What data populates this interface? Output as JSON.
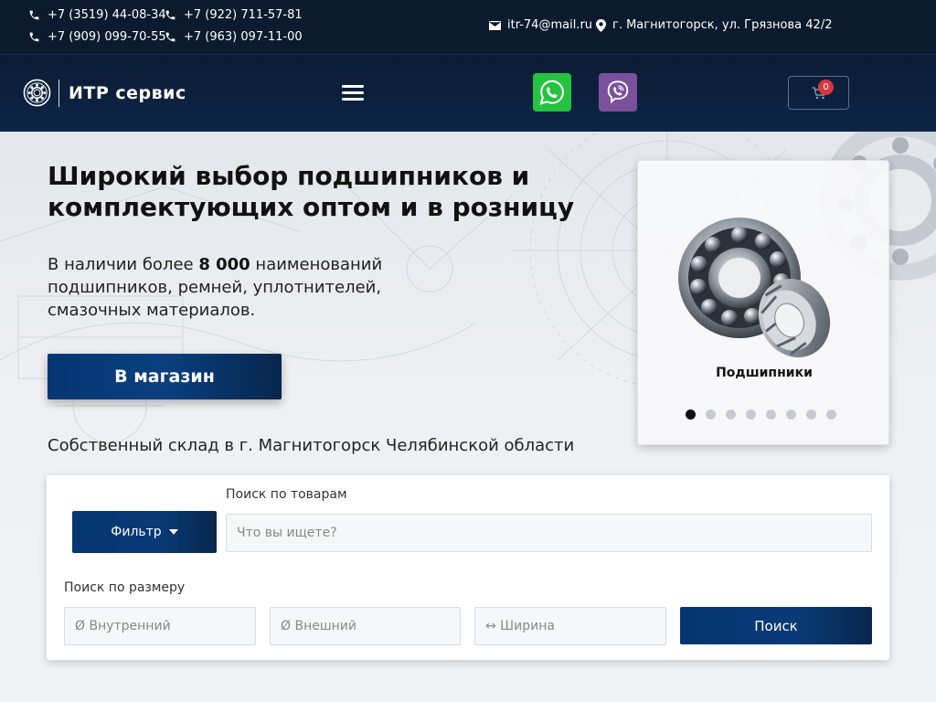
{
  "topbar": {
    "phones": [
      "+7 (3519) 44-08-34",
      "+7 (922) 711-57-81",
      "+7 (909) 099-70-55",
      "+7 (963) 097-11-00"
    ],
    "email": "itr-74@mail.ru",
    "address": "г. Магнитогорск, ул. Грязнова 42/2",
    "icons": {
      "phone": "phone-icon",
      "email": "envelope-icon",
      "address": "map-pin-icon"
    }
  },
  "header": {
    "logo_text": "ИТР сервис",
    "cart_count": "0",
    "whatsapp_color": "#25c23f",
    "viber_color": "#7b519d",
    "icons": [
      "bearing-logo-icon",
      "menu-icon",
      "whatsapp-icon",
      "viber-icon",
      "cart-icon"
    ]
  },
  "hero": {
    "title": "Широкий выбор подшипников и комплектующих оптом и в розницу",
    "text_before": "В наличии более ",
    "text_bold": "8 000",
    "text_after": " наименований подшипников, ремней, уплотнителей, смазочных материалов.",
    "shop_button": "В магазин",
    "warehouse": "Собственный склад в г. Магнитогорск Челябинской области"
  },
  "slider": {
    "caption": "Подшипники",
    "dot_count": 8,
    "active_index": 0
  },
  "search": {
    "filter_button": "Фильтр",
    "products_label": "Поиск по товарам",
    "products_placeholder": "Что вы ищете?",
    "size_label": "Поиск по размеру",
    "inner_placeholder": "Ø Внутренний",
    "outer_placeholder": "Ø Внешний",
    "width_placeholder": "↔ Ширина",
    "search_button": "Поиск"
  },
  "colors": {
    "brand_dark": "#0c1a2e",
    "button_blue": "#093a77",
    "badge_red": "#d7373f"
  }
}
